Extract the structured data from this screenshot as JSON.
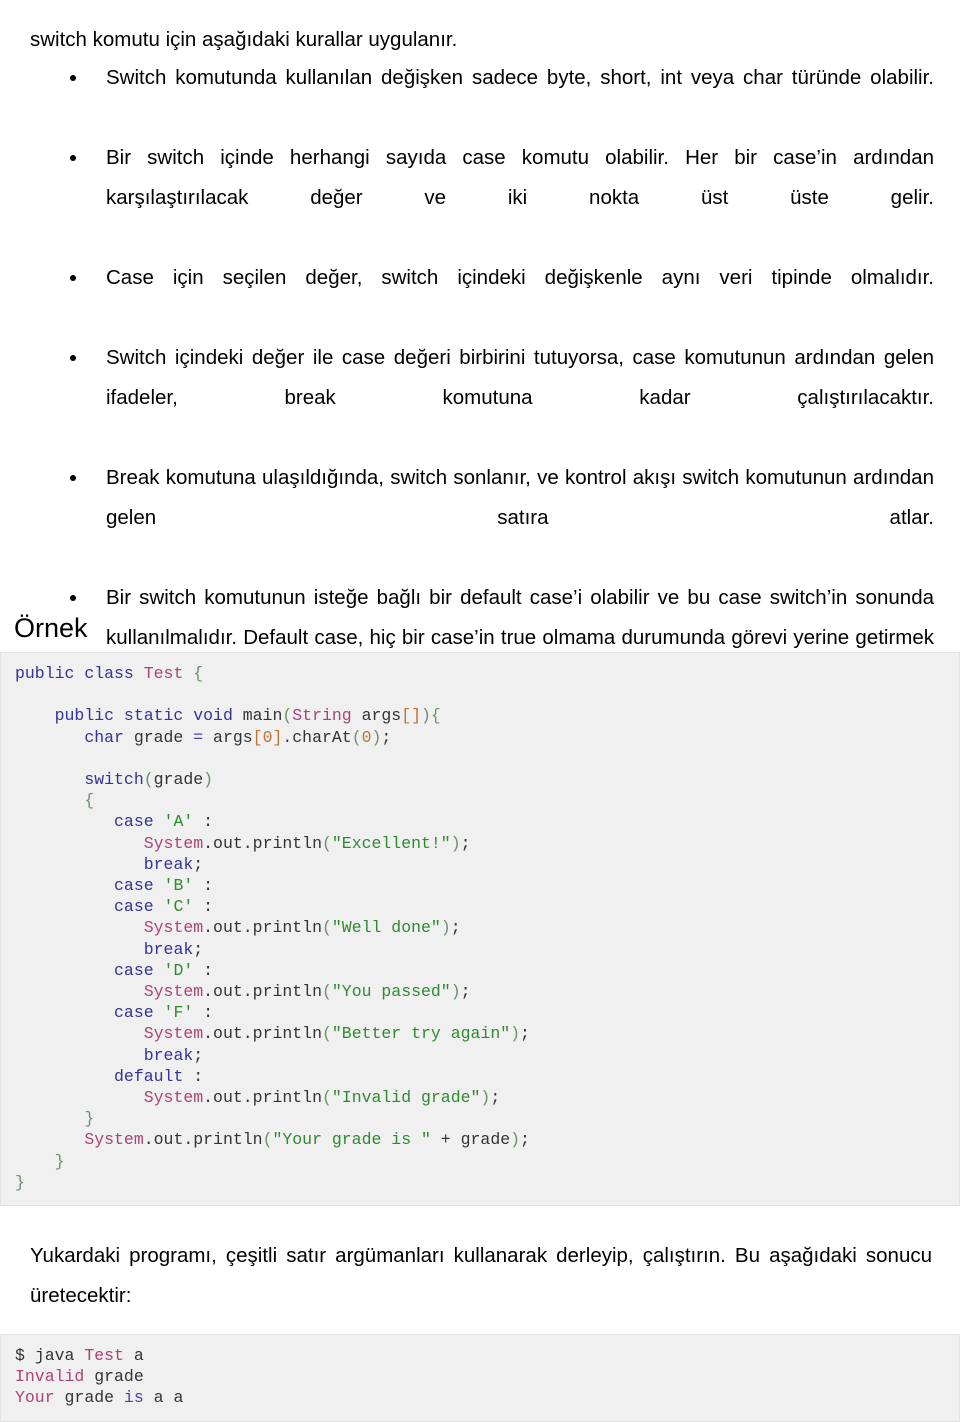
{
  "document": {
    "intro_line": "switch komutu için aşağıdaki kurallar uygulanır.",
    "rules": [
      "Switch komutunda kullanılan değişken sadece byte, short, int veya char türünde olabilir.",
      "Bir switch içinde herhangi sayıda case komutu olabilir. Her bir case’in ardından karşılaştırılacak değer ve iki nokta üst üste gelir.",
      "Case için seçilen değer, switch içindeki değişkenle aynı veri tipinde olmalıdır.",
      "Switch içindeki değer ile case değeri birbirini tutuyorsa, case komutunun ardından gelen ifadeler, break komutuna kadar çalıştırılacaktır.",
      "Break komutuna ulaşıldığında, switch sonlanır, ve kontrol akışı switch komutunun ardından gelen satıra atlar.",
      "Bir switch komutunun isteğe bağlı bir default case’i olabilir ve bu case switch’in sonunda kullanılmalıdır. Default case, hiç bir case’in true olmama durumunda görevi yerine getirmek için kullanılır. Default case içinde break kullanımı gerekmez."
    ],
    "example_heading": "Örnek",
    "closing_paragraph": "Yukardaki programı, çeşitli satır argümanları kullanarak derleyip, çalıştırın. Bu aşağıdaki sonucu üretecektir:",
    "code_tokens": [
      [
        [
          "public ",
          "kw"
        ],
        [
          "class ",
          "kw"
        ],
        [
          "Test",
          "type"
        ],
        [
          " ",
          "plain"
        ],
        [
          "{",
          "punc"
        ]
      ],
      [
        [
          "",
          "plain"
        ]
      ],
      [
        [
          "    ",
          "plain"
        ],
        [
          "public ",
          "kw"
        ],
        [
          "static ",
          "kw"
        ],
        [
          "void ",
          "kw"
        ],
        [
          "main",
          "plain"
        ],
        [
          "(",
          "punc"
        ],
        [
          "String",
          "type"
        ],
        [
          " args",
          "plain"
        ],
        [
          "[]",
          "num"
        ],
        [
          ")",
          "punc"
        ],
        [
          "{",
          "punc"
        ]
      ],
      [
        [
          "       ",
          "plain"
        ],
        [
          "char",
          "kw"
        ],
        [
          " grade ",
          "plain"
        ],
        [
          "=",
          "blue"
        ],
        [
          " args",
          "plain"
        ],
        [
          "[",
          "num"
        ],
        [
          "0",
          "num"
        ],
        [
          "]",
          "num"
        ],
        [
          ".charAt",
          "plain"
        ],
        [
          "(",
          "punc"
        ],
        [
          "0",
          "num"
        ],
        [
          ")",
          "punc"
        ],
        [
          ";",
          "plain"
        ]
      ],
      [
        [
          "",
          "plain"
        ]
      ],
      [
        [
          "       ",
          "plain"
        ],
        [
          "switch",
          "kw"
        ],
        [
          "(",
          "punc"
        ],
        [
          "grade",
          "plain"
        ],
        [
          ")",
          "punc"
        ]
      ],
      [
        [
          "       ",
          "plain"
        ],
        [
          "{",
          "punc"
        ]
      ],
      [
        [
          "          ",
          "plain"
        ],
        [
          "case ",
          "kw"
        ],
        [
          "'A'",
          "str"
        ],
        [
          " :",
          "plain"
        ]
      ],
      [
        [
          "             ",
          "plain"
        ],
        [
          "System",
          "type"
        ],
        [
          ".out.println",
          "plain"
        ],
        [
          "(",
          "punc"
        ],
        [
          "\"Excellent!\"",
          "str"
        ],
        [
          ")",
          "punc"
        ],
        [
          ";",
          "plain"
        ]
      ],
      [
        [
          "             ",
          "plain"
        ],
        [
          "break",
          "kw"
        ],
        [
          ";",
          "plain"
        ]
      ],
      [
        [
          "          ",
          "plain"
        ],
        [
          "case ",
          "kw"
        ],
        [
          "'B'",
          "str"
        ],
        [
          " :",
          "plain"
        ]
      ],
      [
        [
          "          ",
          "plain"
        ],
        [
          "case ",
          "kw"
        ],
        [
          "'C'",
          "str"
        ],
        [
          " :",
          "plain"
        ]
      ],
      [
        [
          "             ",
          "plain"
        ],
        [
          "System",
          "type"
        ],
        [
          ".out.println",
          "plain"
        ],
        [
          "(",
          "punc"
        ],
        [
          "\"Well done\"",
          "str"
        ],
        [
          ")",
          "punc"
        ],
        [
          ";",
          "plain"
        ]
      ],
      [
        [
          "             ",
          "plain"
        ],
        [
          "break",
          "kw"
        ],
        [
          ";",
          "plain"
        ]
      ],
      [
        [
          "          ",
          "plain"
        ],
        [
          "case ",
          "kw"
        ],
        [
          "'D'",
          "str"
        ],
        [
          " :",
          "plain"
        ]
      ],
      [
        [
          "             ",
          "plain"
        ],
        [
          "System",
          "type"
        ],
        [
          ".out.println",
          "plain"
        ],
        [
          "(",
          "punc"
        ],
        [
          "\"You passed\"",
          "str"
        ],
        [
          ")",
          "punc"
        ],
        [
          ";",
          "plain"
        ]
      ],
      [
        [
          "          ",
          "plain"
        ],
        [
          "case ",
          "kw"
        ],
        [
          "'F'",
          "str"
        ],
        [
          " :",
          "plain"
        ]
      ],
      [
        [
          "             ",
          "plain"
        ],
        [
          "System",
          "type"
        ],
        [
          ".out.println",
          "plain"
        ],
        [
          "(",
          "punc"
        ],
        [
          "\"Better try again\"",
          "str"
        ],
        [
          ")",
          "punc"
        ],
        [
          ";",
          "plain"
        ]
      ],
      [
        [
          "             ",
          "plain"
        ],
        [
          "break",
          "kw"
        ],
        [
          ";",
          "plain"
        ]
      ],
      [
        [
          "          ",
          "plain"
        ],
        [
          "default",
          "kw"
        ],
        [
          " :",
          "plain"
        ]
      ],
      [
        [
          "             ",
          "plain"
        ],
        [
          "System",
          "type"
        ],
        [
          ".out.println",
          "plain"
        ],
        [
          "(",
          "punc"
        ],
        [
          "\"Invalid grade\"",
          "str"
        ],
        [
          ")",
          "punc"
        ],
        [
          ";",
          "plain"
        ]
      ],
      [
        [
          "       ",
          "plain"
        ],
        [
          "}",
          "punc"
        ]
      ],
      [
        [
          "       ",
          "plain"
        ],
        [
          "System",
          "type"
        ],
        [
          ".out.println",
          "plain"
        ],
        [
          "(",
          "punc"
        ],
        [
          "\"Your grade is \"",
          "str"
        ],
        [
          " + grade",
          "plain"
        ],
        [
          ")",
          "punc"
        ],
        [
          ";",
          "plain"
        ]
      ],
      [
        [
          "    ",
          "plain"
        ],
        [
          "}",
          "punc"
        ]
      ],
      [
        [
          "}",
          "punc"
        ]
      ]
    ],
    "output_tokens": [
      [
        [
          "$ java ",
          "plain"
        ],
        [
          "Test",
          "type"
        ],
        [
          " a",
          "plain"
        ]
      ],
      [
        [
          "Invalid",
          "type"
        ],
        [
          " grade",
          "plain"
        ]
      ],
      [
        [
          "Your",
          "type"
        ],
        [
          " grade ",
          "plain"
        ],
        [
          "is",
          "blue"
        ],
        [
          " a a",
          "plain"
        ]
      ]
    ]
  },
  "colors": {
    "code_background": "#f0f0f0",
    "code_border": "#e2e2e2",
    "keyword": "#333399",
    "type": "#aa4477",
    "string": "#2f8a2f",
    "number": "#bb7733",
    "punctuation": "#6f8f6f",
    "plain": "#333333",
    "text": "#000000",
    "page_background": "#ffffff"
  }
}
